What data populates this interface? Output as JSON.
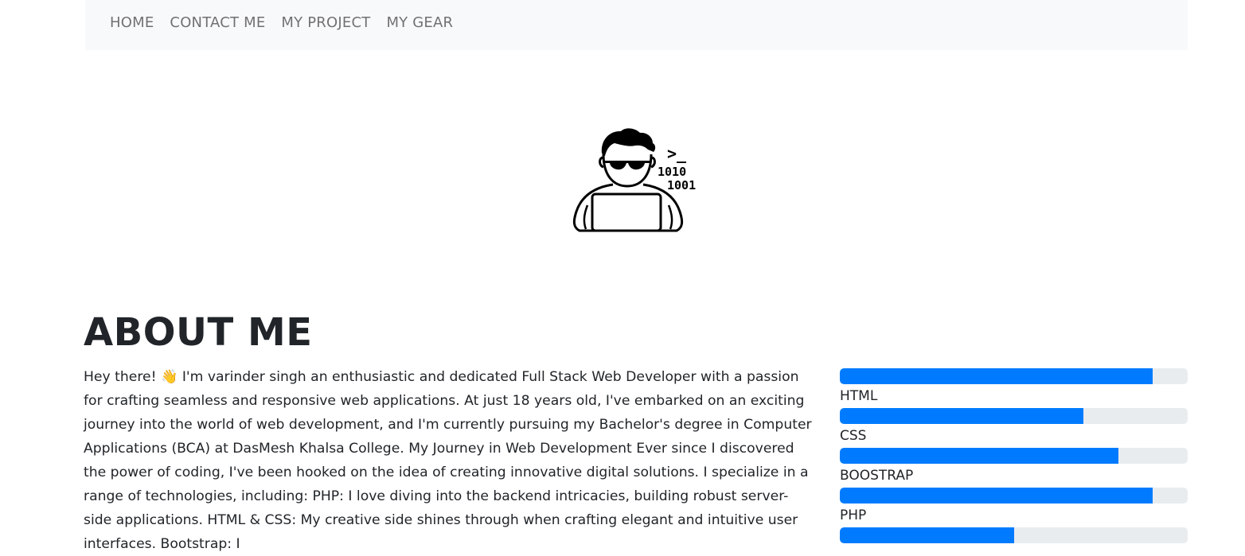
{
  "nav": {
    "items": [
      {
        "label": "HOME"
      },
      {
        "label": "CONTACT ME"
      },
      {
        "label": "MY PROJECT"
      },
      {
        "label": "MY GEAR"
      }
    ]
  },
  "hero": {
    "icon": "developer-avatar-icon",
    "prompt_text": ">_",
    "binary_line_1": "1010",
    "binary_line_2": "1001"
  },
  "about": {
    "title": "ABOUT ME",
    "text": "Hey there! 👋 I'm varinder singh an enthusiastic and dedicated Full Stack Web Developer with a passion for crafting seamless and responsive web applications. At just 18 years old, I've embarked on an exciting journey into the world of web development, and I'm currently pursuing my Bachelor's degree in Computer Applications (BCA) at DasMesh Khalsa College. My Journey in Web Development Ever since I discovered the power of coding, I've been hooked on the idea of creating innovative digital solutions. I specialize in a range of technologies, including: PHP: I love diving into the backend intricacies, building robust server-side applications. HTML & CSS: My creative side shines through when crafting elegant and intuitive user interfaces. Bootstrap: I"
  },
  "skills": [
    {
      "label": "",
      "level": 0.9
    },
    {
      "label": "HTML",
      "level": 0.7
    },
    {
      "label": "CSS",
      "level": 0.8
    },
    {
      "label": "BOOSTRAP",
      "level": 0.9
    },
    {
      "label": "PHP",
      "level": 0.5
    }
  ],
  "colors": {
    "accent": "#007bff",
    "track": "#e9ecef",
    "navbar_bg": "#f8f9fa"
  }
}
